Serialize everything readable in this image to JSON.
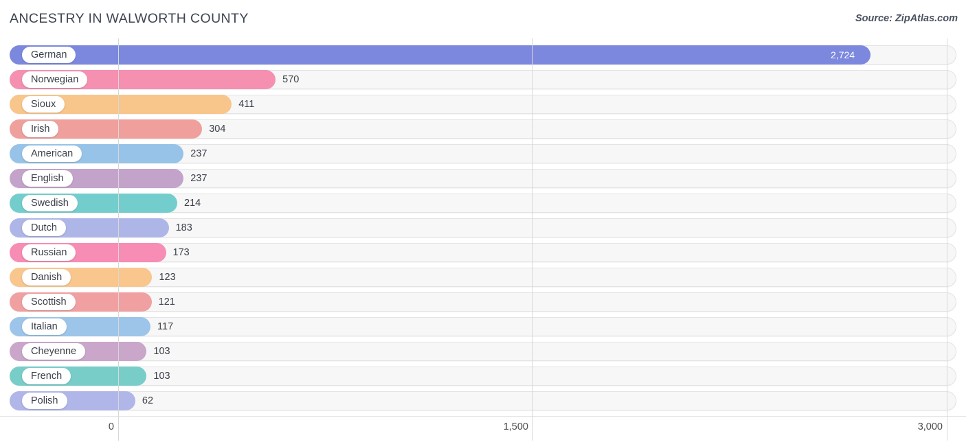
{
  "header": {
    "title": "ANCESTRY IN WALWORTH COUNTY",
    "source": "Source: ZipAtlas.com"
  },
  "chart_data": {
    "type": "bar",
    "orientation": "horizontal",
    "title": "ANCESTRY IN WALWORTH COUNTY",
    "xlabel": "",
    "ylabel": "",
    "xlim": [
      0,
      3000
    ],
    "grid": true,
    "legend": "none",
    "xticks": [
      "0",
      "1,500",
      "3,000"
    ],
    "xtick_values": [
      0,
      1500,
      3000
    ],
    "categories": [
      "German",
      "Norwegian",
      "Sioux",
      "Irish",
      "American",
      "English",
      "Swedish",
      "Dutch",
      "Russian",
      "Danish",
      "Scottish",
      "Italian",
      "Cheyenne",
      "French",
      "Polish"
    ],
    "values": [
      2724,
      570,
      411,
      304,
      237,
      237,
      214,
      183,
      173,
      123,
      121,
      117,
      103,
      103,
      62
    ],
    "value_labels": [
      "2,724",
      "570",
      "411",
      "304",
      "237",
      "237",
      "214",
      "183",
      "173",
      "123",
      "121",
      "117",
      "103",
      "103",
      "62"
    ],
    "colors": [
      "#7b88dd",
      "#f590b1",
      "#f8c58a",
      "#ef9f9c",
      "#97c3e8",
      "#c4a3cb",
      "#74cdcd",
      "#aeb6e8",
      "#f78cb4",
      "#f9c68d",
      "#f0a0a1",
      "#9cc5e9",
      "#c9a6ca",
      "#78cdc9",
      "#b0b6e8"
    ],
    "rows": [
      {
        "label": "German",
        "value": 2724,
        "value_label": "2,724",
        "color": "#7b88dd",
        "value_inside": true
      },
      {
        "label": "Norwegian",
        "value": 570,
        "value_label": "570",
        "color": "#f590b1",
        "value_inside": false
      },
      {
        "label": "Sioux",
        "value": 411,
        "value_label": "411",
        "color": "#f8c58a",
        "value_inside": false
      },
      {
        "label": "Irish",
        "value": 304,
        "value_label": "304",
        "color": "#ef9f9c",
        "value_inside": false
      },
      {
        "label": "American",
        "value": 237,
        "value_label": "237",
        "color": "#97c3e8",
        "value_inside": false
      },
      {
        "label": "English",
        "value": 237,
        "value_label": "237",
        "color": "#c4a3cb",
        "value_inside": false
      },
      {
        "label": "Swedish",
        "value": 214,
        "value_label": "214",
        "color": "#74cdcd",
        "value_inside": false
      },
      {
        "label": "Dutch",
        "value": 183,
        "value_label": "183",
        "color": "#aeb6e8",
        "value_inside": false
      },
      {
        "label": "Russian",
        "value": 173,
        "value_label": "173",
        "color": "#f78cb4",
        "value_inside": false
      },
      {
        "label": "Danish",
        "value": 123,
        "value_label": "123",
        "color": "#f9c68d",
        "value_inside": false
      },
      {
        "label": "Scottish",
        "value": 121,
        "value_label": "121",
        "color": "#f0a0a1",
        "value_inside": false
      },
      {
        "label": "Italian",
        "value": 117,
        "value_label": "117",
        "color": "#9cc5e9",
        "value_inside": false
      },
      {
        "label": "Cheyenne",
        "value": 103,
        "value_label": "103",
        "color": "#c9a6ca",
        "value_inside": false
      },
      {
        "label": "French",
        "value": 103,
        "value_label": "103",
        "color": "#78cdc9",
        "value_inside": false
      },
      {
        "label": "Polish",
        "value": 62,
        "value_label": "62",
        "color": "#b0b6e8",
        "value_inside": false
      }
    ]
  }
}
